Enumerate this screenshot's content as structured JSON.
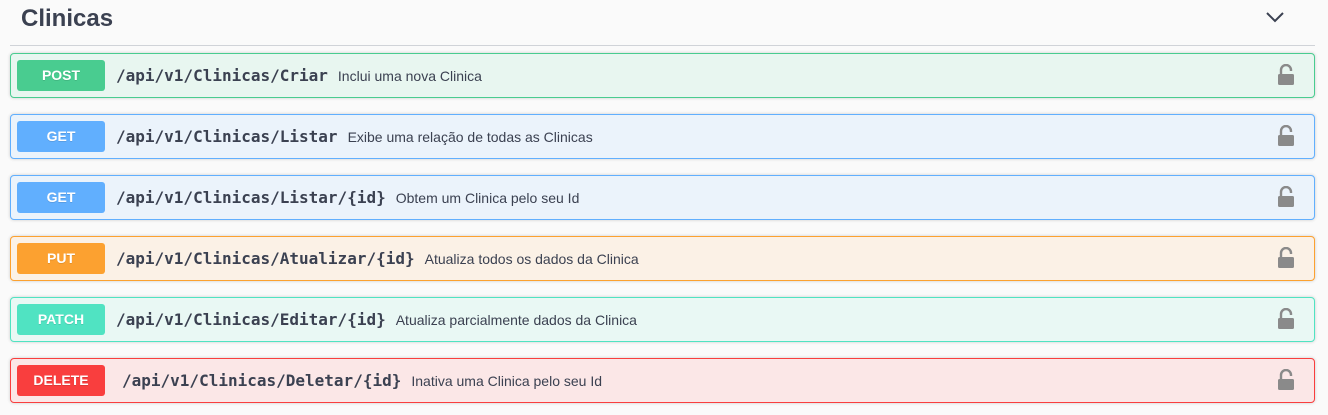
{
  "section": {
    "title": "Clinicas",
    "collapse_icon": "chevron-down-icon"
  },
  "operations": [
    {
      "method": "POST",
      "path": "/api/v1/Clinicas/Criar",
      "description": "Inclui uma nova Clinica",
      "lock_icon": "unlocked-padlock-icon",
      "badge_color": "#49cc90",
      "bg_color": "#e8f6f0",
      "border_color": "#49cc90"
    },
    {
      "method": "GET",
      "path": "/api/v1/Clinicas/Listar",
      "description": "Exibe uma relação de todas as Clinicas",
      "lock_icon": "unlocked-padlock-icon",
      "badge_color": "#61affe",
      "bg_color": "#ebf3fb",
      "border_color": "#61affe"
    },
    {
      "method": "GET",
      "path": "/api/v1/Clinicas/Listar/{id}",
      "description": "Obtem um Clinica pelo seu Id",
      "lock_icon": "unlocked-padlock-icon",
      "badge_color": "#61affe",
      "bg_color": "#ebf3fb",
      "border_color": "#61affe"
    },
    {
      "method": "PUT",
      "path": "/api/v1/Clinicas/Atualizar/{id}",
      "description": "Atualiza todos os dados da Clinica",
      "lock_icon": "unlocked-padlock-icon",
      "badge_color": "#fca130",
      "bg_color": "#fbf1e6",
      "border_color": "#fca130"
    },
    {
      "method": "PATCH",
      "path": "/api/v1/Clinicas/Editar/{id}",
      "description": "Atualiza parcialmente dados da Clinica",
      "lock_icon": "unlocked-padlock-icon",
      "badge_color": "#50e3c2",
      "bg_color": "#e9f8f4",
      "border_color": "#50e3c2"
    },
    {
      "method": "DELETE",
      "path": "/api/v1/Clinicas/Deletar/{id}",
      "description": "Inativa uma Clinica pelo seu Id",
      "lock_icon": "unlocked-padlock-icon",
      "badge_color": "#f93e3e",
      "bg_color": "#fbe7e7",
      "border_color": "#f93e3e"
    }
  ]
}
